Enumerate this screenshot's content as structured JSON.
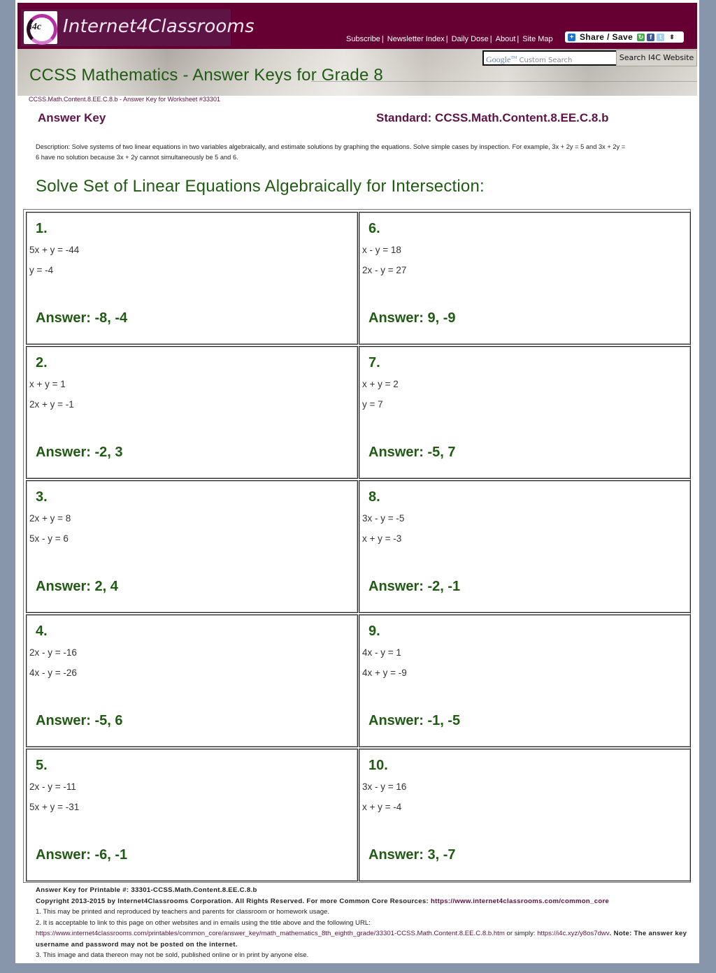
{
  "header": {
    "logo_mark": "i4c",
    "logo_text": "Internet4Classrooms",
    "nav": [
      {
        "label": "Subscribe"
      },
      {
        "label": "Newsletter Index"
      },
      {
        "label": "Daily Dose"
      },
      {
        "label": "About"
      },
      {
        "label": "Site Map"
      }
    ],
    "share": {
      "label": "Share / Save",
      "icons": [
        "share-plus-icon",
        "google-share-icon",
        "facebook-icon",
        "twitter-icon",
        "more-arrows-icon"
      ]
    }
  },
  "banner": {
    "title": "CCSS Mathematics - Answer Keys for Grade 8",
    "search": {
      "placeholder_brand": "Google",
      "placeholder_tm": "TM",
      "placeholder_text": "Custom Search",
      "value": ""
    },
    "search_button": "Search I4C Website"
  },
  "breadcrumb": "CCSS.Math.Content.8.EE.C.8.b - Answer Key for Worksheet #33301",
  "answer_key_label": "Answer Key",
  "standard_label": "Standard: CCSS.Math.Content.8.EE.C.8.b",
  "description_line1": "Description: Solve systems of two linear equations in two variables algebraically, and estimate solutions by graphing the equations. Solve simple cases by inspection. For example, 3x + 2y = 5 and 3x + 2y =",
  "description_line2": "6 have no solution because 3x + 2y cannot simultaneously be 5 and 6.",
  "section_title": "Solve Set of Linear Equations Algebraically for Intersection:",
  "problems": [
    {
      "number": "1.",
      "eq1": "5x + y = -44",
      "eq2": "y = -4",
      "answer": "Answer: -8, -4"
    },
    {
      "number": "2.",
      "eq1": "x + y = 1",
      "eq2": "2x + y = -1",
      "answer": "Answer: -2, 3"
    },
    {
      "number": "3.",
      "eq1": "2x + y = 8",
      "eq2": "5x - y = 6",
      "answer": "Answer: 2, 4"
    },
    {
      "number": "4.",
      "eq1": "2x - y = -16",
      "eq2": "4x - y = -26",
      "answer": "Answer: -5, 6"
    },
    {
      "number": "5.",
      "eq1": "2x - y = -11",
      "eq2": "5x + y = -31",
      "answer": "Answer: -6, -1"
    },
    {
      "number": "6.",
      "eq1": "x - y = 18",
      "eq2": "2x - y = 27",
      "answer": "Answer: 9, -9"
    },
    {
      "number": "7.",
      "eq1": "x + y = 2",
      "eq2": "y = 7",
      "answer": "Answer: -5, 7"
    },
    {
      "number": "8.",
      "eq1": "3x - y = -5",
      "eq2": "x + y = -3",
      "answer": "Answer: -2, -1"
    },
    {
      "number": "9.",
      "eq1": "4x - y = 1",
      "eq2": "4x + y = -9",
      "answer": "Answer: -1, -5"
    },
    {
      "number": "10.",
      "eq1": "3x - y = 16",
      "eq2": "x + y = -4",
      "answer": "Answer: 3, -7"
    }
  ],
  "footer": {
    "printable": "Answer Key for Printable #: 33301-CCSS.Math.Content.8.EE.C.8.b",
    "copyright": "Copyright 2013-2015 by Internet4Classrooms Corporation. All Rights Reserved. For more Common Core Resources: ",
    "copyright_link": "https://www.internet4classrooms.com/common_core",
    "rule1": "1. This may be printed and reproduced by teachers and parents for classroom or homework usage.",
    "rule2": "2. It is acceptable to link to this page on other websites and in emails using the title above and the following URL:",
    "url_long": "https://www.internet4classrooms.com/printables/common_core/answer_key/math_mathematics_8th_eighth_grade/33301-CCSS.Math.Content.8.EE.C.8.b.htm",
    "or_simply": " or simply: ",
    "url_short": "https://i4c.xyz/y8os7dwv",
    "note": ". Note: The answer key username and password may not be posted on the internet.",
    "rule3": "3. This image and data thereon may not be sold, published online or in print by anyone else."
  }
}
